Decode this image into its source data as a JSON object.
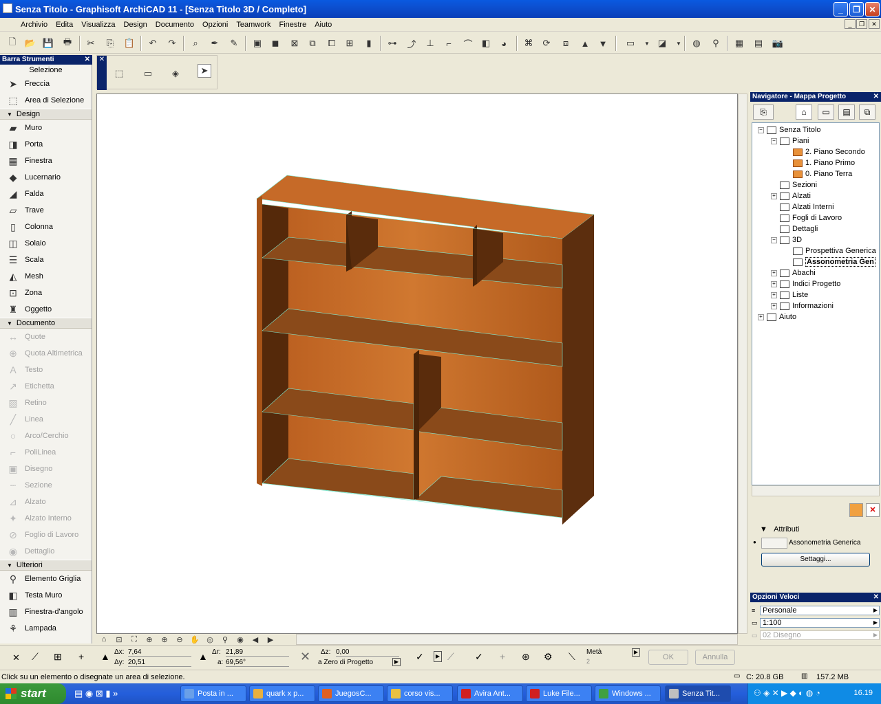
{
  "window": {
    "title": "Senza Titolo - Graphisoft ArchiCAD 11 - [Senza Titolo 3D / Completo]"
  },
  "menu": [
    "Archivio",
    "Edita",
    "Visualizza",
    "Design",
    "Documento",
    "Opzioni",
    "Teamwork",
    "Finestre",
    "Aiuto"
  ],
  "toolbox": {
    "title": "Barra Strumenti",
    "selezione_label": "Selezione",
    "selezione": [
      {
        "label": "Freccia",
        "icon": "arrow-icon"
      },
      {
        "label": "Area di Selezione",
        "icon": "marquee-icon"
      }
    ],
    "design_label": "Design",
    "design": [
      {
        "label": "Muro",
        "icon": "wall-icon"
      },
      {
        "label": "Porta",
        "icon": "door-icon"
      },
      {
        "label": "Finestra",
        "icon": "window-icon"
      },
      {
        "label": "Lucernario",
        "icon": "skylight-icon"
      },
      {
        "label": "Falda",
        "icon": "roof-icon"
      },
      {
        "label": "Trave",
        "icon": "beam-icon"
      },
      {
        "label": "Colonna",
        "icon": "column-icon"
      },
      {
        "label": "Solaio",
        "icon": "slab-icon"
      },
      {
        "label": "Scala",
        "icon": "stair-icon"
      },
      {
        "label": "Mesh",
        "icon": "mesh-icon"
      },
      {
        "label": "Zona",
        "icon": "zone-icon"
      },
      {
        "label": "Oggetto",
        "icon": "object-icon"
      }
    ],
    "documento_label": "Documento",
    "documento": [
      {
        "label": "Quote",
        "icon": "dimension-icon"
      },
      {
        "label": "Quota Altimetrica",
        "icon": "level-dimension-icon"
      },
      {
        "label": "Testo",
        "icon": "text-icon"
      },
      {
        "label": "Etichetta",
        "icon": "label-icon"
      },
      {
        "label": "Retino",
        "icon": "fill-icon"
      },
      {
        "label": "Linea",
        "icon": "line-icon"
      },
      {
        "label": "Arco/Cerchio",
        "icon": "arc-icon"
      },
      {
        "label": "PoliLinea",
        "icon": "polyline-icon"
      },
      {
        "label": "Disegno",
        "icon": "drawing-icon"
      },
      {
        "label": "Sezione",
        "icon": "section-icon"
      },
      {
        "label": "Alzato",
        "icon": "elevation-icon"
      },
      {
        "label": "Alzato Interno",
        "icon": "interior-elevation-icon"
      },
      {
        "label": "Foglio di Lavoro",
        "icon": "worksheet-icon"
      },
      {
        "label": "Dettaglio",
        "icon": "detail-icon"
      }
    ],
    "ulteriori_label": "Ulteriori",
    "ulteriori": [
      {
        "label": "Elemento Griglia",
        "icon": "grid-element-icon"
      },
      {
        "label": "Testa Muro",
        "icon": "wall-end-icon"
      },
      {
        "label": "Finestra-d'angolo",
        "icon": "corner-window-icon"
      },
      {
        "label": "Lampada",
        "icon": "lamp-icon"
      }
    ]
  },
  "navigator": {
    "title": "Navigatore - Mappa Progetto",
    "tree": [
      {
        "label": "Senza Titolo",
        "level": 0,
        "pm": "−"
      },
      {
        "label": "Piani",
        "level": 1,
        "pm": "−"
      },
      {
        "label": "2. Piano Secondo",
        "level": 2,
        "pm": ""
      },
      {
        "label": "1. Piano Primo",
        "level": 2,
        "pm": ""
      },
      {
        "label": "0. Piano Terra",
        "level": 2,
        "pm": ""
      },
      {
        "label": "Sezioni",
        "level": 1,
        "pm": ""
      },
      {
        "label": "Alzati",
        "level": 1,
        "pm": "+"
      },
      {
        "label": "Alzati Interni",
        "level": 1,
        "pm": ""
      },
      {
        "label": "Fogli di Lavoro",
        "level": 1,
        "pm": ""
      },
      {
        "label": "Dettagli",
        "level": 1,
        "pm": ""
      },
      {
        "label": "3D",
        "level": 1,
        "pm": "−"
      },
      {
        "label": "Prospettiva Generica",
        "level": 2,
        "pm": ""
      },
      {
        "label": "Assonometria Gen",
        "level": 2,
        "pm": "",
        "selected": true
      },
      {
        "label": "Abachi",
        "level": 1,
        "pm": "+"
      },
      {
        "label": "Indici Progetto",
        "level": 1,
        "pm": "+"
      },
      {
        "label": "Liste",
        "level": 1,
        "pm": "+"
      },
      {
        "label": "Informazioni",
        "level": 1,
        "pm": "+"
      },
      {
        "label": "Aiuto",
        "level": 0,
        "pm": "+"
      }
    ],
    "attributes_label": "Attributi",
    "attribute_value": "Assonometria Generica",
    "settings_button": "Settaggi..."
  },
  "quick_options": {
    "title": "Opzioni Veloci",
    "rows": [
      "Personale",
      "1:100",
      "02 Disegno"
    ]
  },
  "infobar": {
    "dx_label": "Δx:",
    "dx": "7,64",
    "dy_label": "Δy:",
    "dy": "20,51",
    "dr_label": "Δr:",
    "dr": "21,89",
    "a_label": "a:",
    "a": "69,56°",
    "dz_label": "Δz:",
    "dz": "0,00",
    "ref": "a Zero di Progetto",
    "meta_label": "Metà",
    "meta_value": "2",
    "ok": "OK",
    "annulla": "Annulla"
  },
  "status": {
    "message": "Click su un elemento o disegnate un area di selezione.",
    "disk": "C: 20.8 GB",
    "memory": "157.2 MB"
  },
  "taskbar": {
    "start": "start",
    "tasks": [
      "Posta in ...",
      "quark x p...",
      "JuegosC...",
      "corso vis...",
      "Avira Ant...",
      "Luke File...",
      "Windows ...",
      "Senza Tit..."
    ],
    "clock": "16.19"
  },
  "colors": {
    "accent": "#0a246a",
    "wood_light": "#c8702a",
    "wood_dark": "#6a3410"
  }
}
